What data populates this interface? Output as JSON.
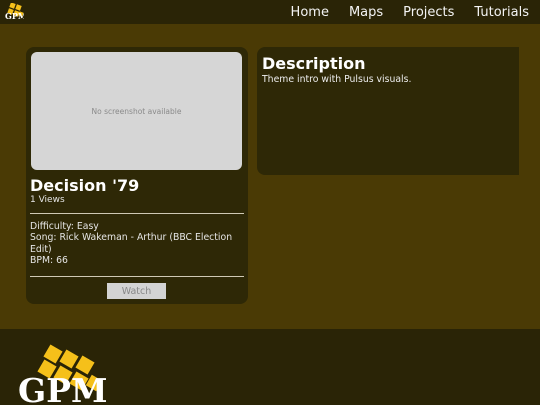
{
  "nav": {
    "brand": "GPM",
    "items": [
      "Home",
      "Maps",
      "Projects",
      "Tutorials"
    ]
  },
  "map": {
    "thumbnail_text": "No screenshot available",
    "title": "Decision '79",
    "views": "1 Views",
    "difficulty": "Difficulty: Easy",
    "song": "Song: Rick Wakeman - Arthur (BBC Election Edit)",
    "bpm": "BPM: 66",
    "watch_label": "Watch"
  },
  "description": {
    "heading": "Description",
    "text": "Theme intro with Pulsus visuals."
  },
  "footer": {
    "logo_text": "GPM"
  },
  "colors": {
    "background": "#4a3a05",
    "bars": "#2a2406",
    "panel": "#2e2806",
    "logo_yellow": "#f5c01a"
  }
}
